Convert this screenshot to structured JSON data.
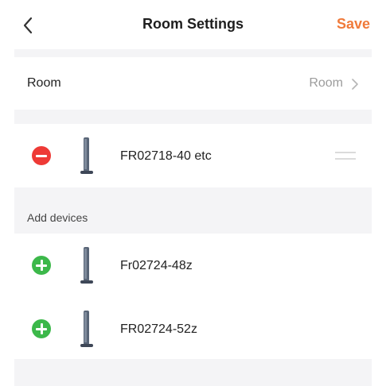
{
  "header": {
    "title": "Room Settings",
    "save_label": "Save",
    "back_icon": "chevron-left-icon",
    "accent_color": "#f07a3a"
  },
  "room": {
    "label": "Room",
    "value": "Room"
  },
  "current_devices": [
    {
      "name": "FR02718-40 etc",
      "action": "remove"
    }
  ],
  "add_section": {
    "label": "Add devices",
    "devices": [
      {
        "name": "Fr02724-48z",
        "action": "add"
      },
      {
        "name": "FR02724-52z",
        "action": "add"
      }
    ]
  },
  "colors": {
    "remove": "#ee3a36",
    "add": "#3cb84a",
    "divider": "#f4f4f6"
  }
}
